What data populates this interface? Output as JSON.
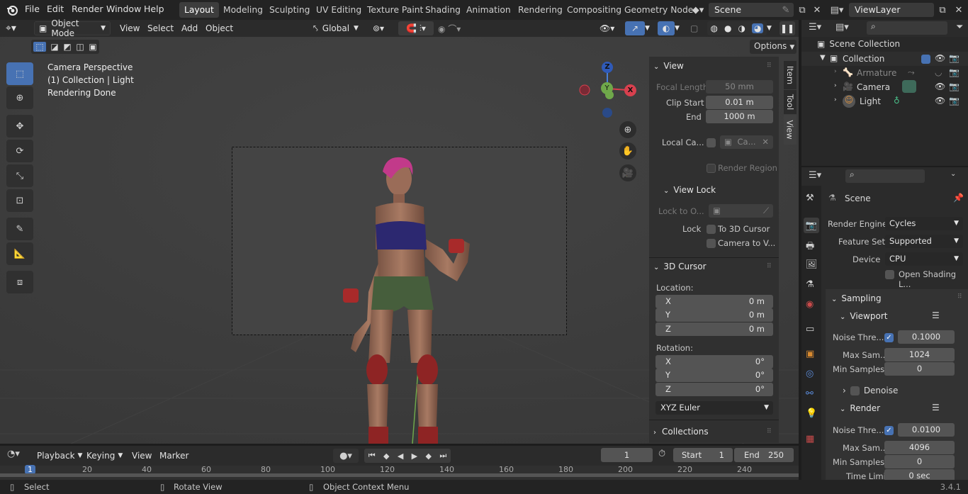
{
  "menus": [
    "File",
    "Edit",
    "Render",
    "Window",
    "Help"
  ],
  "workspaces": [
    "Layout",
    "Modeling",
    "Sculpting",
    "UV Editing",
    "Texture Paint",
    "Shading",
    "Animation",
    "Rendering",
    "Compositing",
    "Geometry Node"
  ],
  "scene_name": "Scene",
  "view_layer": "ViewLayer",
  "viewport_header": {
    "mode": "Object Mode",
    "menus": [
      "View",
      "Select",
      "Add",
      "Object"
    ],
    "transform": "Global",
    "options": "Options"
  },
  "overlay_text": {
    "line1": "Camera Perspective",
    "line2": "(1) Collection | Light",
    "line3": "Rendering Done"
  },
  "gizmo": {
    "z": "Z",
    "y": "Y",
    "x": "X"
  },
  "npanel": {
    "tabs": [
      "Item",
      "Tool",
      "View"
    ],
    "view_title": "View",
    "focal_label": "Focal Length",
    "focal_value": "50 mm",
    "clip_start_label": "Clip Start",
    "clip_start_value": "0.01 m",
    "end_label": "End",
    "end_value": "1000 m",
    "local_cam_label": "Local Ca...",
    "local_cam_value": "Ca...",
    "render_region": "Render Region",
    "view_lock_title": "View Lock",
    "lock_to_label": "Lock to O...",
    "lock_label": "Lock",
    "to_cursor": "To 3D Cursor",
    "camera_to_view": "Camera to V...",
    "cursor_title": "3D Cursor",
    "location_label": "Location:",
    "rotation_label": "Rotation:",
    "loc": [
      {
        "axis": "X",
        "value": "0 m"
      },
      {
        "axis": "Y",
        "value": "0 m"
      },
      {
        "axis": "Z",
        "value": "0 m"
      }
    ],
    "rot": [
      {
        "axis": "X",
        "value": "0°"
      },
      {
        "axis": "Y",
        "value": "0°"
      },
      {
        "axis": "Z",
        "value": "0°"
      }
    ],
    "euler": "XYZ Euler",
    "collections": "Collections"
  },
  "outliner": {
    "scene_collection": "Scene Collection",
    "collection": "Collection",
    "items": [
      "Armature",
      "Camera",
      "Light"
    ]
  },
  "properties": {
    "context": "Scene",
    "render_engine_label": "Render Engine",
    "render_engine": "Cycles",
    "feature_set_label": "Feature Set",
    "feature_set": "Supported",
    "device_label": "Device",
    "device": "CPU",
    "open_shading": "Open Shading L...",
    "sampling": "Sampling",
    "viewport": "Viewport",
    "noise_label": "Noise Thre...",
    "vp_noise": "0.1000",
    "max_label": "Max Sam...",
    "vp_max": "1024",
    "min_label": "Min Samples",
    "vp_min": "0",
    "denoise": "Denoise",
    "render": "Render",
    "r_noise": "0.0100",
    "r_max_label": "Max Sam...",
    "r_max": "4096",
    "r_min": "0",
    "time_limit_label": "Time Limit",
    "time_limit": "0 sec"
  },
  "timeline": {
    "menus": [
      "Playback",
      "Keying",
      "View",
      "Marker"
    ],
    "current_frame": "1",
    "start_label": "Start",
    "start": "1",
    "end_label": "End",
    "end": "250",
    "ticks": [
      "1",
      "20",
      "40",
      "60",
      "80",
      "100",
      "120",
      "140",
      "160",
      "180",
      "200",
      "220",
      "240"
    ]
  },
  "statusbar": {
    "select": "Select",
    "rotate": "Rotate View",
    "context": "Object Context Menu",
    "version": "3.4.1"
  }
}
